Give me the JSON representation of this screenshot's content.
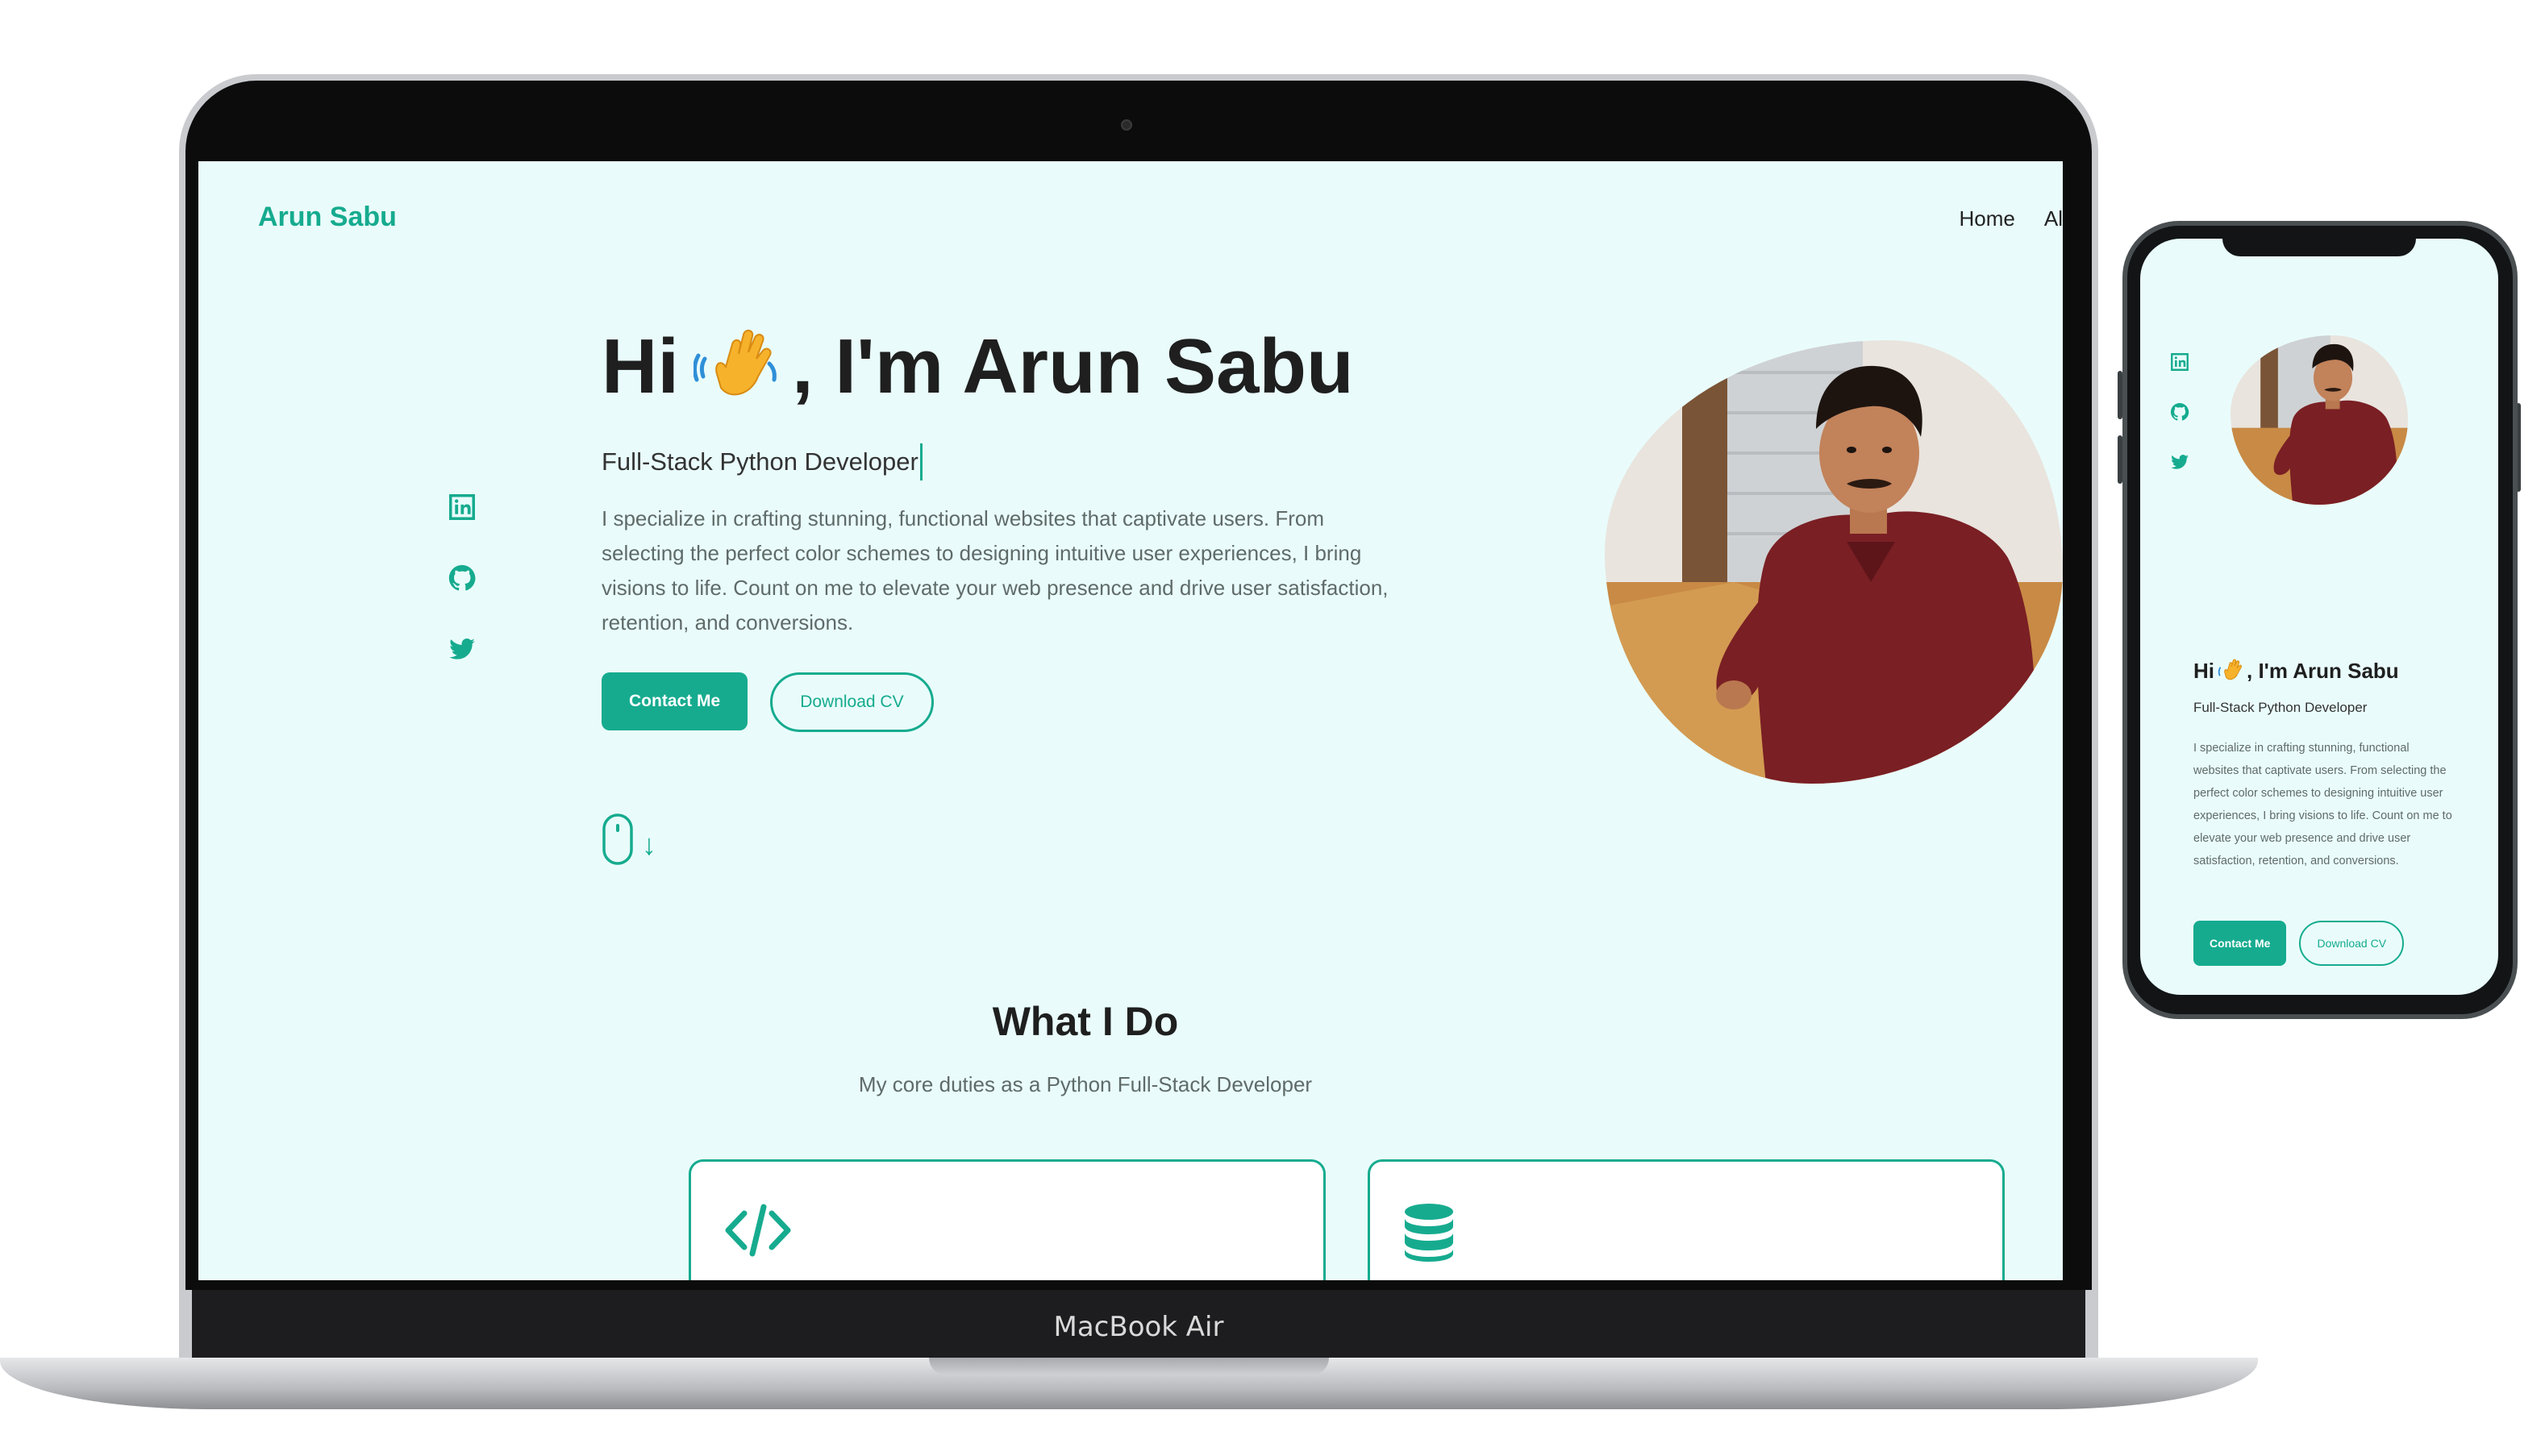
{
  "device_labels": {
    "laptop_model": "MacBook Air"
  },
  "site": {
    "brand": "Arun Sabu",
    "nav": {
      "home": "Home",
      "about_partial": "Al"
    },
    "hero": {
      "greeting_prefix": "Hi",
      "greeting_suffix": ", I'm Arun Sabu",
      "subtitle": "Full-Stack Python Developer",
      "description": "I specialize in crafting stunning, functional websites that captivate users. From selecting the perfect color schemes to designing intuitive user experiences, I bring visions to life. Count on me to elevate your web presence and drive user satisfaction, retention, and conversions.",
      "contact_button": "Contact Me",
      "download_button": "Download CV",
      "scroll_arrow": "↓"
    },
    "social_icons": [
      "linkedin-icon",
      "github-icon",
      "twitter-icon"
    ],
    "services": {
      "title": "What I Do",
      "subtitle": "My core duties as a Python Full-Stack Developer",
      "cards": [
        {
          "icon": "code-icon"
        },
        {
          "icon": "database-icon"
        }
      ]
    }
  },
  "colors": {
    "accent": "#16ab8f",
    "page_bg": "#e9fcfb",
    "heading": "#1f1f1f"
  }
}
